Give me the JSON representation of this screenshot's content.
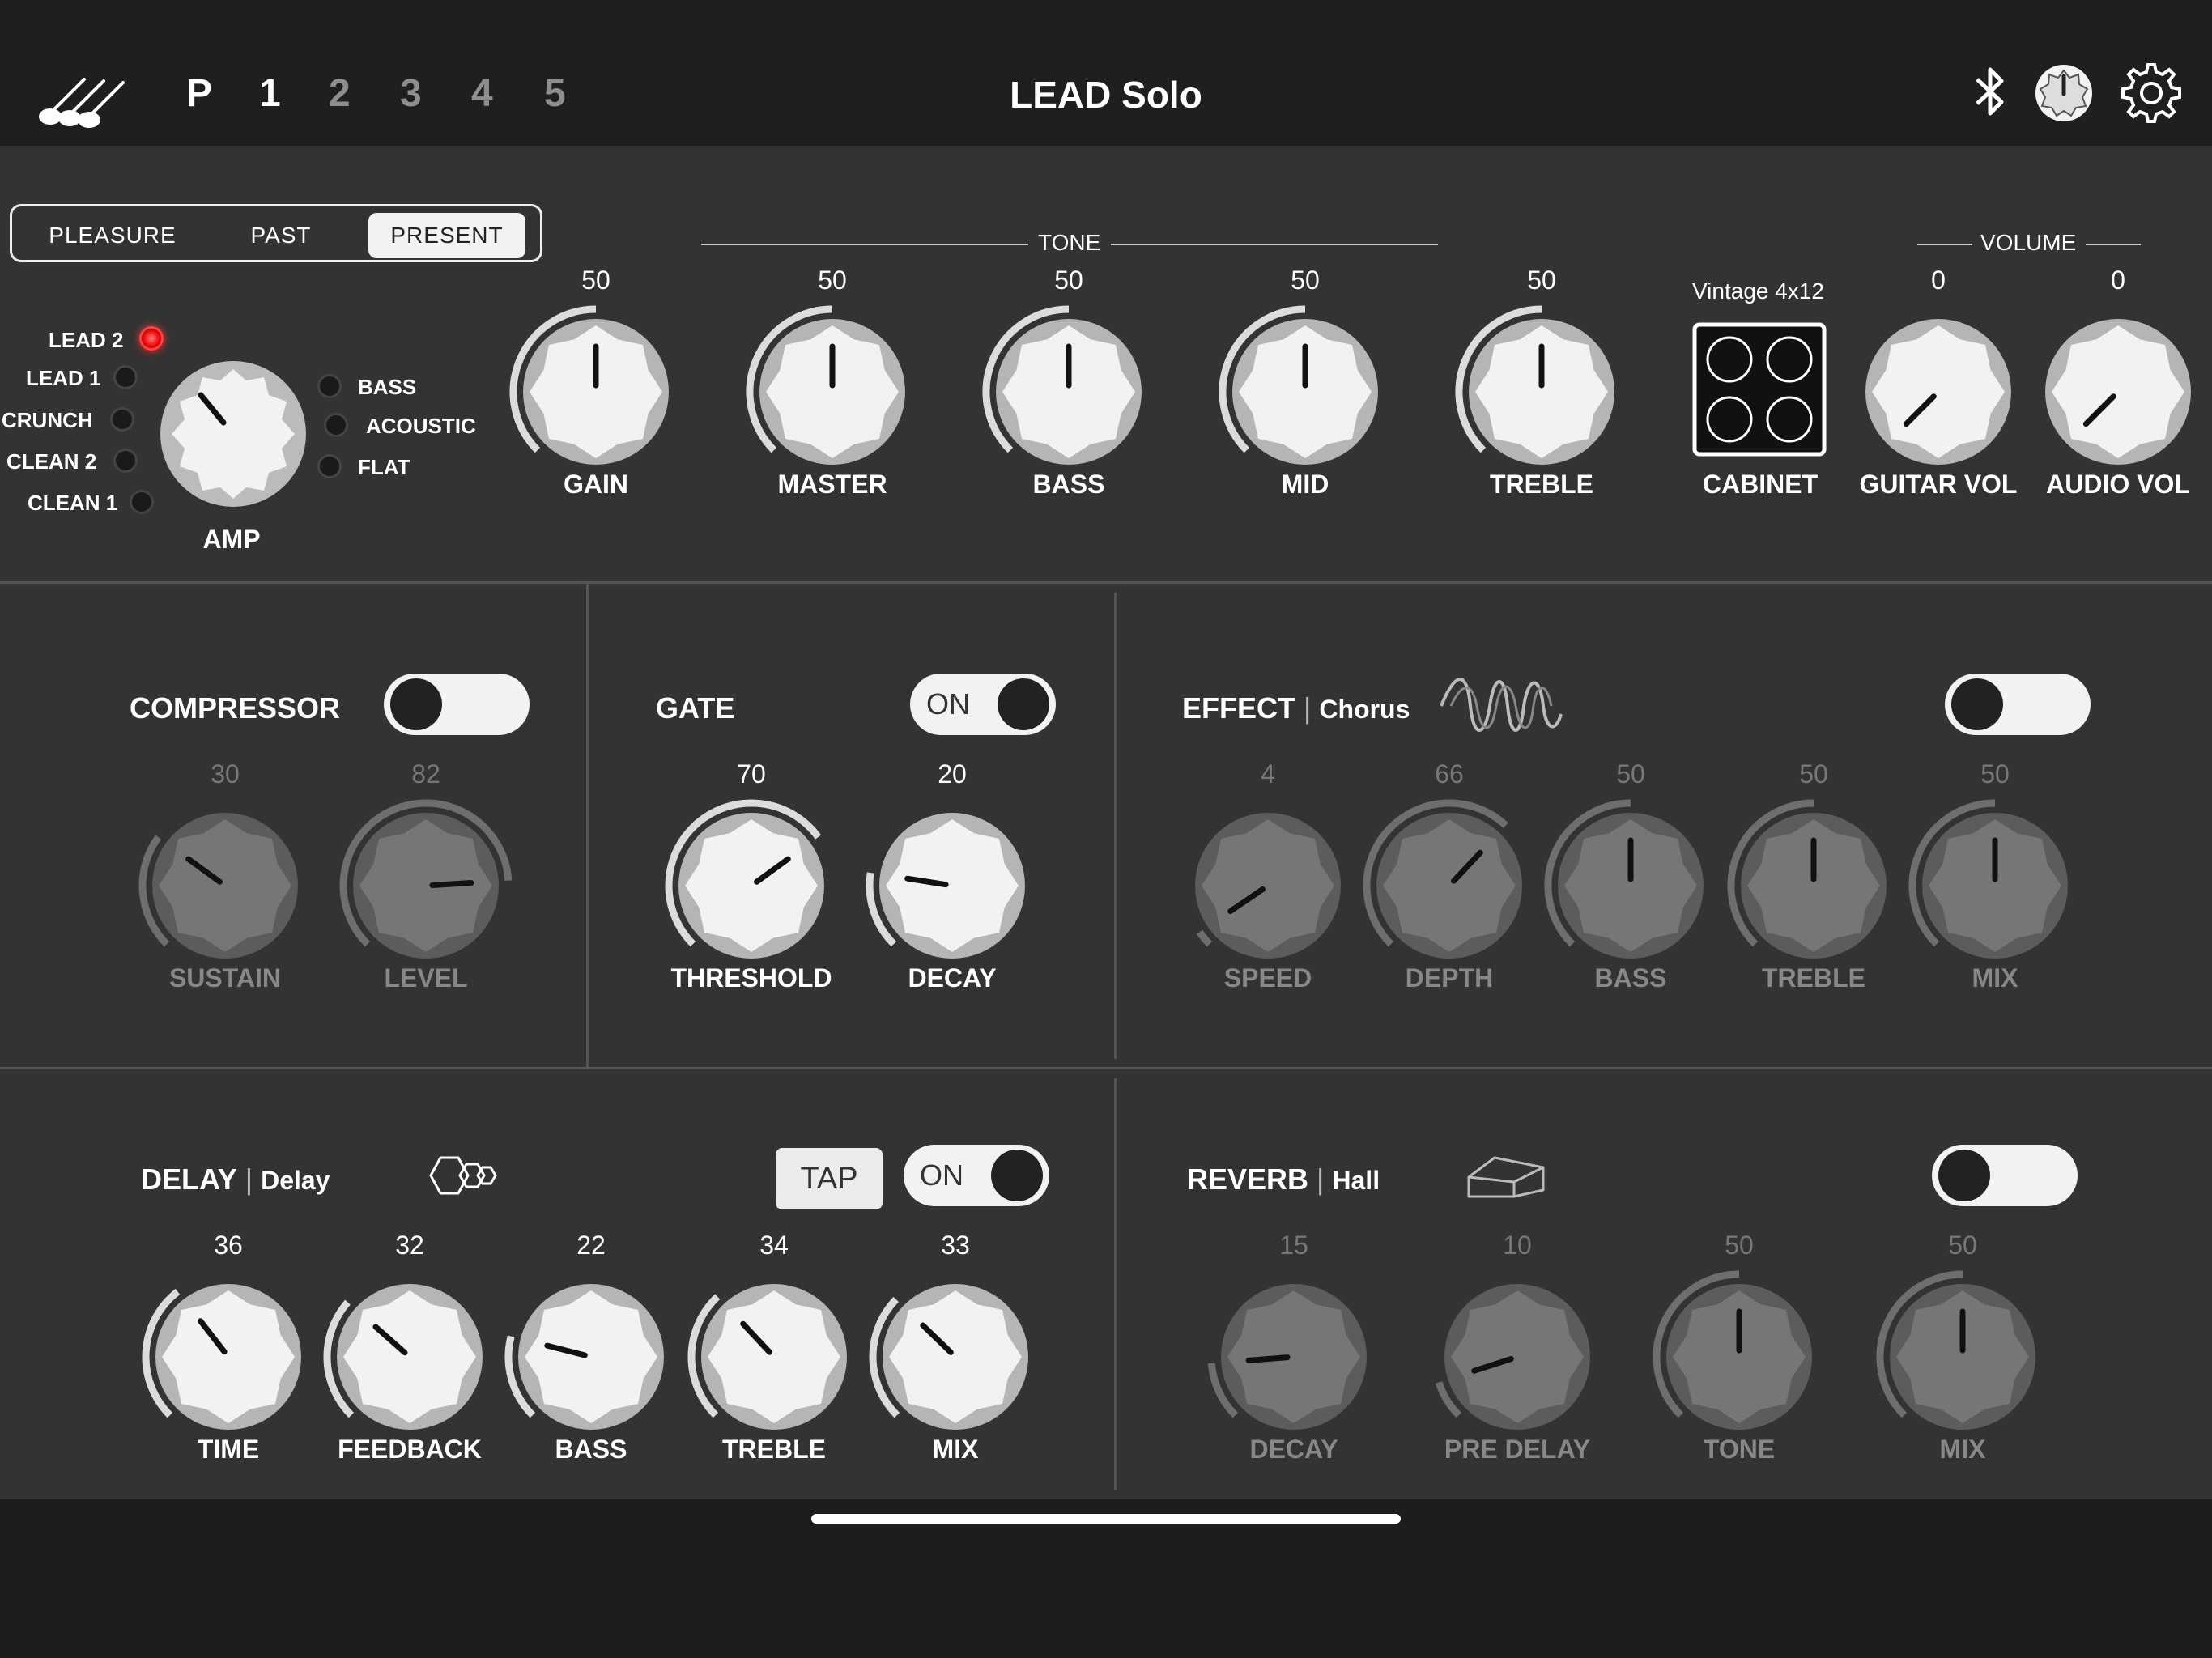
{
  "header": {
    "presets": [
      "P",
      "1",
      "2",
      "3",
      "4",
      "5"
    ],
    "active_presets": [
      0,
      1
    ],
    "title": "LEAD Solo",
    "icons": [
      "guitars-logo-icon",
      "bluetooth-icon",
      "tuner-icon",
      "gear-icon"
    ]
  },
  "amp_section": {
    "modes": [
      "PLEASURE",
      "PAST",
      "PRESENT"
    ],
    "active_mode": "PRESENT",
    "amp_types_left": [
      "LEAD 2",
      "LEAD 1",
      "CRUNCH",
      "CLEAN 2",
      "CLEAN 1"
    ],
    "amp_types_right": [
      "BASS",
      "ACOUSTIC",
      "FLAT"
    ],
    "selected_amp": "LEAD 2",
    "amp_label": "AMP",
    "tone_header": "TONE",
    "volume_header": "VOLUME",
    "tone_knobs": [
      {
        "label": "GAIN",
        "value": "50"
      },
      {
        "label": "MASTER",
        "value": "50"
      },
      {
        "label": "BASS",
        "value": "50"
      },
      {
        "label": "MID",
        "value": "50"
      },
      {
        "label": "TREBLE",
        "value": "50"
      }
    ],
    "cabinet": {
      "name": "Vintage 4x12",
      "label": "CABINET"
    },
    "volume_knobs": [
      {
        "label": "GUITAR VOL",
        "value": "0"
      },
      {
        "label": "AUDIO VOL",
        "value": "0"
      }
    ]
  },
  "compressor": {
    "title": "COMPRESSOR",
    "enabled": false,
    "knobs": [
      {
        "label": "SUSTAIN",
        "value": "30"
      },
      {
        "label": "LEVEL",
        "value": "82"
      }
    ]
  },
  "gate": {
    "title": "GATE",
    "enabled": true,
    "toggle_label": "ON",
    "knobs": [
      {
        "label": "THRESHOLD",
        "value": "70"
      },
      {
        "label": "DECAY",
        "value": "20"
      }
    ]
  },
  "effect": {
    "title": "EFFECT",
    "type": "Chorus",
    "enabled": false,
    "icon": "chorus-wave-icon",
    "knobs": [
      {
        "label": "SPEED",
        "value": "4"
      },
      {
        "label": "DEPTH",
        "value": "66"
      },
      {
        "label": "BASS",
        "value": "50"
      },
      {
        "label": "TREBLE",
        "value": "50"
      },
      {
        "label": "MIX",
        "value": "50"
      }
    ]
  },
  "delay": {
    "title": "DELAY",
    "type": "Delay",
    "enabled": true,
    "toggle_label": "ON",
    "tap_label": "TAP",
    "icon": "delay-hexagons-icon",
    "knobs": [
      {
        "label": "TIME",
        "value": "36"
      },
      {
        "label": "FEEDBACK",
        "value": "32"
      },
      {
        "label": "BASS",
        "value": "22"
      },
      {
        "label": "TREBLE",
        "value": "34"
      },
      {
        "label": "MIX",
        "value": "33"
      }
    ]
  },
  "reverb": {
    "title": "REVERB",
    "type": "Hall",
    "enabled": false,
    "icon": "hall-room-icon",
    "knobs": [
      {
        "label": "DECAY",
        "value": "15"
      },
      {
        "label": "PRE DELAY",
        "value": "10"
      },
      {
        "label": "TONE",
        "value": "50"
      },
      {
        "label": "MIX",
        "value": "50"
      }
    ]
  },
  "colors": {
    "background": "#333333",
    "topbar": "#1f1f1f",
    "led_active": "#ff2020",
    "knob_face": "#f2f2f2",
    "knob_dim": "#7a7a7a"
  }
}
